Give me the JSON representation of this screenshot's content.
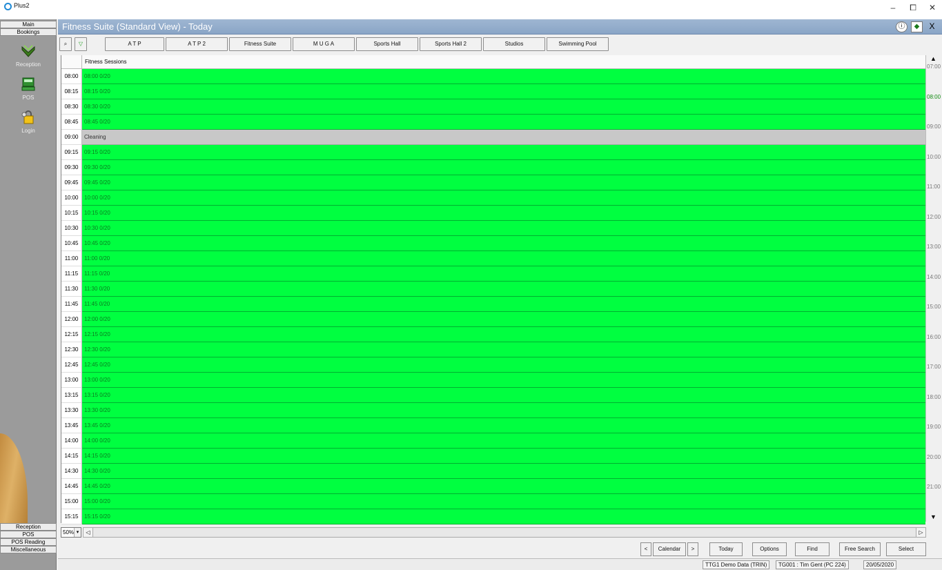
{
  "window": {
    "title": "Plus2",
    "controls": [
      "–",
      "⧠",
      "✕"
    ]
  },
  "leftnav": {
    "top_tabs": [
      "Main",
      "Bookings"
    ],
    "items": [
      {
        "label": "Reception",
        "icon": "reception-icon"
      },
      {
        "label": "POS",
        "icon": "pos-register-icon"
      },
      {
        "label": "Login",
        "icon": "login-padlock-icon"
      }
    ],
    "bottom_tabs": [
      "Reception",
      "POS",
      "POS Reading",
      "Miscellaneous"
    ]
  },
  "header": {
    "title": "Fitness Suite (Standard View) - Today",
    "info_icon": "ⓘ",
    "nav_icon": "◆",
    "close": "X"
  },
  "toolbar": {
    "search_icon": "⌕",
    "filter_icon": "▽",
    "tabs": [
      "A T P",
      "A T P 2",
      "Fitness Suite",
      "M U G A",
      "Sports Hall",
      "Sports Hall 2",
      "Studios",
      "Swimming Pool"
    ]
  },
  "grid": {
    "column_header": "Fitness Sessions",
    "rows": [
      {
        "time": "08:00",
        "slot": "08:00 0/20",
        "status": "available"
      },
      {
        "time": "08:15",
        "slot": "08:15 0/20",
        "status": "available"
      },
      {
        "time": "08:30",
        "slot": "08:30 0/20",
        "status": "available"
      },
      {
        "time": "08:45",
        "slot": "08:45 0/20",
        "status": "available"
      },
      {
        "time": "09:00",
        "slot": "Cleaning",
        "status": "cleaning"
      },
      {
        "time": "09:15",
        "slot": "09:15 0/20",
        "status": "available"
      },
      {
        "time": "09:30",
        "slot": "09:30 0/20",
        "status": "available"
      },
      {
        "time": "09:45",
        "slot": "09:45 0/20",
        "status": "available"
      },
      {
        "time": "10:00",
        "slot": "10:00 0/20",
        "status": "available"
      },
      {
        "time": "10:15",
        "slot": "10:15 0/20",
        "status": "available"
      },
      {
        "time": "10:30",
        "slot": "10:30 0/20",
        "status": "available"
      },
      {
        "time": "10:45",
        "slot": "10:45 0/20",
        "status": "available"
      },
      {
        "time": "11:00",
        "slot": "11:00 0/20",
        "status": "available"
      },
      {
        "time": "11:15",
        "slot": "11:15 0/20",
        "status": "available"
      },
      {
        "time": "11:30",
        "slot": "11:30 0/20",
        "status": "available"
      },
      {
        "time": "11:45",
        "slot": "11:45 0/20",
        "status": "available"
      },
      {
        "time": "12:00",
        "slot": "12:00 0/20",
        "status": "available"
      },
      {
        "time": "12:15",
        "slot": "12:15 0/20",
        "status": "available"
      },
      {
        "time": "12:30",
        "slot": "12:30 0/20",
        "status": "available"
      },
      {
        "time": "12:45",
        "slot": "12:45 0/20",
        "status": "available"
      },
      {
        "time": "13:00",
        "slot": "13:00 0/20",
        "status": "available"
      },
      {
        "time": "13:15",
        "slot": "13:15 0/20",
        "status": "available"
      },
      {
        "time": "13:30",
        "slot": "13:30 0/20",
        "status": "available"
      },
      {
        "time": "13:45",
        "slot": "13:45 0/20",
        "status": "available"
      },
      {
        "time": "14:00",
        "slot": "14:00 0/20",
        "status": "available"
      },
      {
        "time": "14:15",
        "slot": "14:15 0/20",
        "status": "available"
      },
      {
        "time": "14:30",
        "slot": "14:30 0/20",
        "status": "available"
      },
      {
        "time": "14:45",
        "slot": "14:45 0/20",
        "status": "available"
      },
      {
        "time": "15:00",
        "slot": "15:00 0/20",
        "status": "available"
      },
      {
        "time": "15:15",
        "slot": "15:15 0/20",
        "status": "available"
      }
    ]
  },
  "timeline": {
    "labels": [
      "07:00",
      "08:00",
      "09:00",
      "10:00",
      "11:00",
      "12:00",
      "13:00",
      "14:00",
      "15:00",
      "16:00",
      "17:00",
      "18:00",
      "19:00",
      "20:00",
      "21:00"
    ],
    "current": "08:00",
    "up": "▲",
    "down": "▼"
  },
  "footer": {
    "zoom": "50%",
    "zoom_arrow": "▾",
    "prev": "<",
    "calendar": "Calendar",
    "next": ">",
    "today": "Today",
    "options": "Options",
    "find": "Find",
    "free_search": "Free Search",
    "select": "Select",
    "scroll_left": "◁",
    "scroll_right": "▷"
  },
  "status": {
    "database": "TTG1 Demo Data (TRIN)",
    "user": "TG001 : Tim Gent (PC 224)",
    "date": "20/05/2020"
  },
  "colors": {
    "available": "#00ff40",
    "cleaning": "#c8c8c8",
    "header": "#8aa5c6"
  }
}
